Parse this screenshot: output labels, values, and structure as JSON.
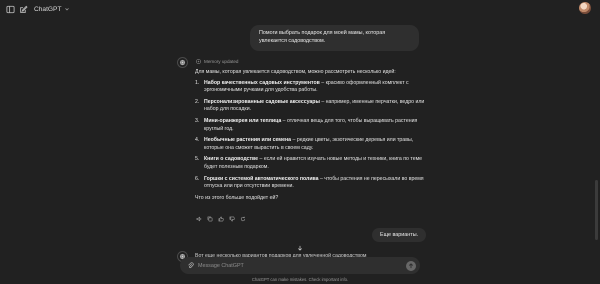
{
  "header": {
    "model_label": "ChatGPT",
    "icons": {
      "sidebar": "sidebar-toggle-icon",
      "new_chat": "new-chat-icon",
      "model_chevron": "chevron-down-icon"
    }
  },
  "conversation": {
    "user_message_1": "Помоги выбрать подарок для моей мамы, которая увлекается садоводством.",
    "memory_note": "Memory updated",
    "assistant": {
      "intro": "Для мамы, которая увлекается садоводством, можно рассмотреть несколько идей:",
      "items": [
        {
          "num": "1.",
          "title": "Набор качественных садовых инструментов",
          "text": " – красиво оформленный комплект с эргономичными ручками для удобства работы."
        },
        {
          "num": "2.",
          "title": "Персонализированные садовые аксессуары",
          "text": " – например, именные перчатки, ведро или набор для посадки."
        },
        {
          "num": "3.",
          "title": "Мини-оранжерея или теплица",
          "text": " – отличная вещь для того, чтобы выращивать растения круглый год."
        },
        {
          "num": "4.",
          "title": "Необычные растения или семена",
          "text": " – редкие цветы, экзотические деревья или травы, которые она сможет вырастить в своем саду."
        },
        {
          "num": "5.",
          "title": "Книги о садоводстве",
          "text": " – если ей нравится изучать новые методы и техники, книга по теме будет полезным подарком."
        },
        {
          "num": "6.",
          "title": "Горшки с системой автоматического полива",
          "text": " – чтобы растения не пересыхали во время отпуска или при отсутствии времени."
        }
      ],
      "outro": "Что из этого больше подойдет ей?"
    },
    "user_message_2": "Еще варианты.",
    "assistant_partial": "Вот еще несколько вариантов подарков для увлеченной садоводством"
  },
  "composer": {
    "placeholder": "Message ChatGPT",
    "disclaimer": "ChatGPT can make mistakes. Check important info."
  },
  "colors": {
    "background": "#212121",
    "bubble": "#2f2f2f",
    "text": "#ececec",
    "muted": "#9a9a9a"
  }
}
